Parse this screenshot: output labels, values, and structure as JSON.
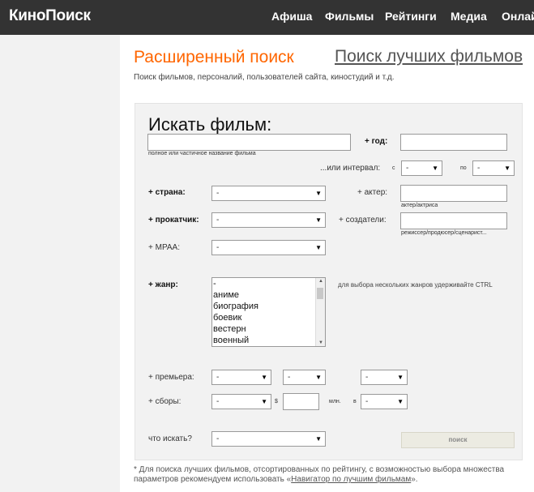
{
  "header": {
    "logo": "КиноПоиск",
    "nav": [
      "Афиша",
      "Фильмы",
      "Рейтинги",
      "Медиа",
      "Онлайн"
    ]
  },
  "page": {
    "title": "Расширенный поиск",
    "top_link": "Поиск лучших фильмов",
    "subtitle": "Поиск фильмов, персоналий, пользователей сайта, киностудий и т.д."
  },
  "form": {
    "title": "Искать фильм:",
    "name_hint": "полное или частичное название фильма",
    "year_label": "+ год:",
    "interval_label": "...или интервал:",
    "from_label": "с",
    "to_label": "по",
    "country_label": "+ страна:",
    "actor_label": "+ актер:",
    "actor_hint": "актер/актриса",
    "distributor_label": "+ прокатчик:",
    "creators_label": "+ создатели:",
    "creators_hint": "режиссер/продюсер/сценарист...",
    "mpaa_label": "+ MPAA:",
    "genre_label": "+ жанр:",
    "genre_hint": "для выбора нескольких жанров удерживайте CTRL",
    "genres": [
      "-",
      "аниме",
      "биография",
      "боевик",
      "вестерн",
      "военный"
    ],
    "premiere_label": "+ премьера:",
    "boxoffice_label": "+ сборы:",
    "currency_symbol": "$",
    "millions_label": "млн.",
    "in_label": "в",
    "what_label": "что искать?",
    "select_default": "-",
    "search_button": "поиск"
  },
  "footnote": {
    "text": "* Для поиска лучших фильмов, отсортированных по рейтингу, с возможностью выбора множества параметров рекомендуем использовать «",
    "link": "Навигатор по лучшим фильмам",
    "tail": "»."
  }
}
